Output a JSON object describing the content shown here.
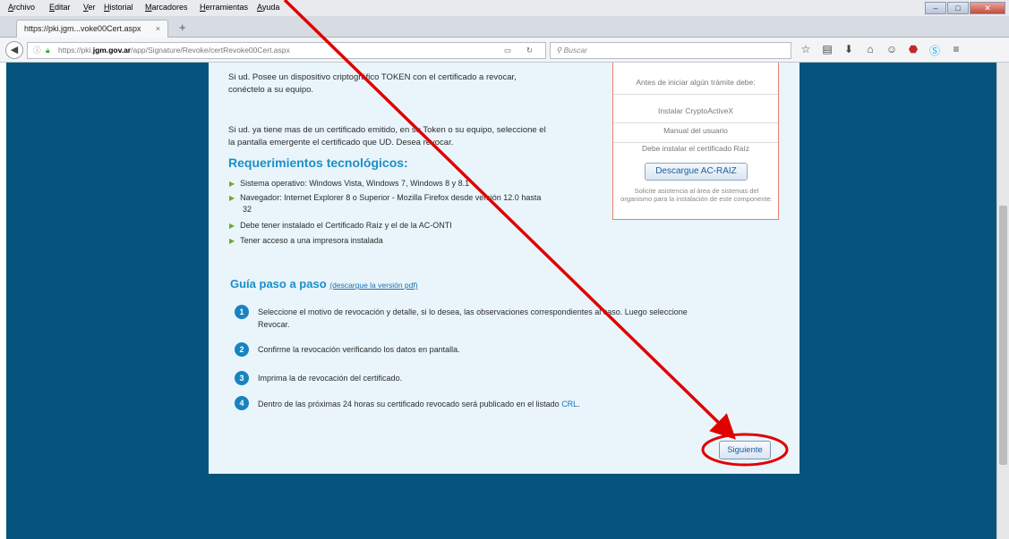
{
  "menu": [
    "Archivo",
    "Editar",
    "Ver",
    "Historial",
    "Marcadores",
    "Herramientas",
    "Ayuda"
  ],
  "tab": {
    "title": "https://pki.jgm...voke00Cert.aspx",
    "close": "×",
    "new_tab": "+"
  },
  "url": {
    "prefix": "https://pki.",
    "domain": "jgm.gov.ar",
    "path": "/app/Signature/Revoke/certRevoke00Cert.aspx"
  },
  "search_placeholder": "Buscar",
  "intro": {
    "p1_line1": "Si ud. Posee un dispositivo criptográfico TOKEN con el certificado a revocar,",
    "p1_line2": "conéctelo a su equipo.",
    "p2_line1": "Si ud. ya tiene mas de un certificado emitido, en su Token o su equipo, seleccione el",
    "p2_line2": "la pantalla emergente el certificado que UD. Desea revocar."
  },
  "requirements": {
    "heading": "Requerimientos tecnológicos:",
    "items": [
      "Sistema operativo: Windows Vista, Windows 7, Windows 8 y 8.1",
      "Navegador: Internet Explorer 8 o Superior - Mozilla Firefox desde versión 12.0 hasta",
      "32",
      "Debe tener instalado el Certificado Raíz y el de la AC-ONTI",
      "Tener acceso a una impresora instalada"
    ]
  },
  "guide": {
    "heading": "Guía paso a paso",
    "link": "(descargue la versión pdf)",
    "steps": [
      {
        "num": "1",
        "line1": "Seleccione el motivo de revocación y detalle, si lo desea, las observaciones correspondientes al caso. Luego seleccione",
        "line2": "Revocar."
      },
      {
        "num": "2",
        "line1": "Confirme la revocación verificando los datos en pantalla."
      },
      {
        "num": "3",
        "line1": "Imprima la de revocación del certificado."
      },
      {
        "num": "4",
        "line1": "Dentro de las próximas 24 horas su certificado revocado será publicado en el listado ",
        "link": "CRL",
        "end": "."
      }
    ]
  },
  "sidebar": {
    "rows": [
      "Antes de iniciar algún trámite debe:",
      "Instalar CryptoActiveX",
      "Manual del usuario",
      "Debe instalar el certificado Raíz"
    ],
    "button": "Descargue AC-RAIZ",
    "assist": "Solicite asistencia al área de sistemas del organismo para la instalación de este componente."
  },
  "next_button": "Siguiente",
  "colors": {
    "annotation": "#e00000",
    "page_bg": "#06547d",
    "content_bg": "#e9f5fb",
    "accent": "#1a8fc8"
  }
}
